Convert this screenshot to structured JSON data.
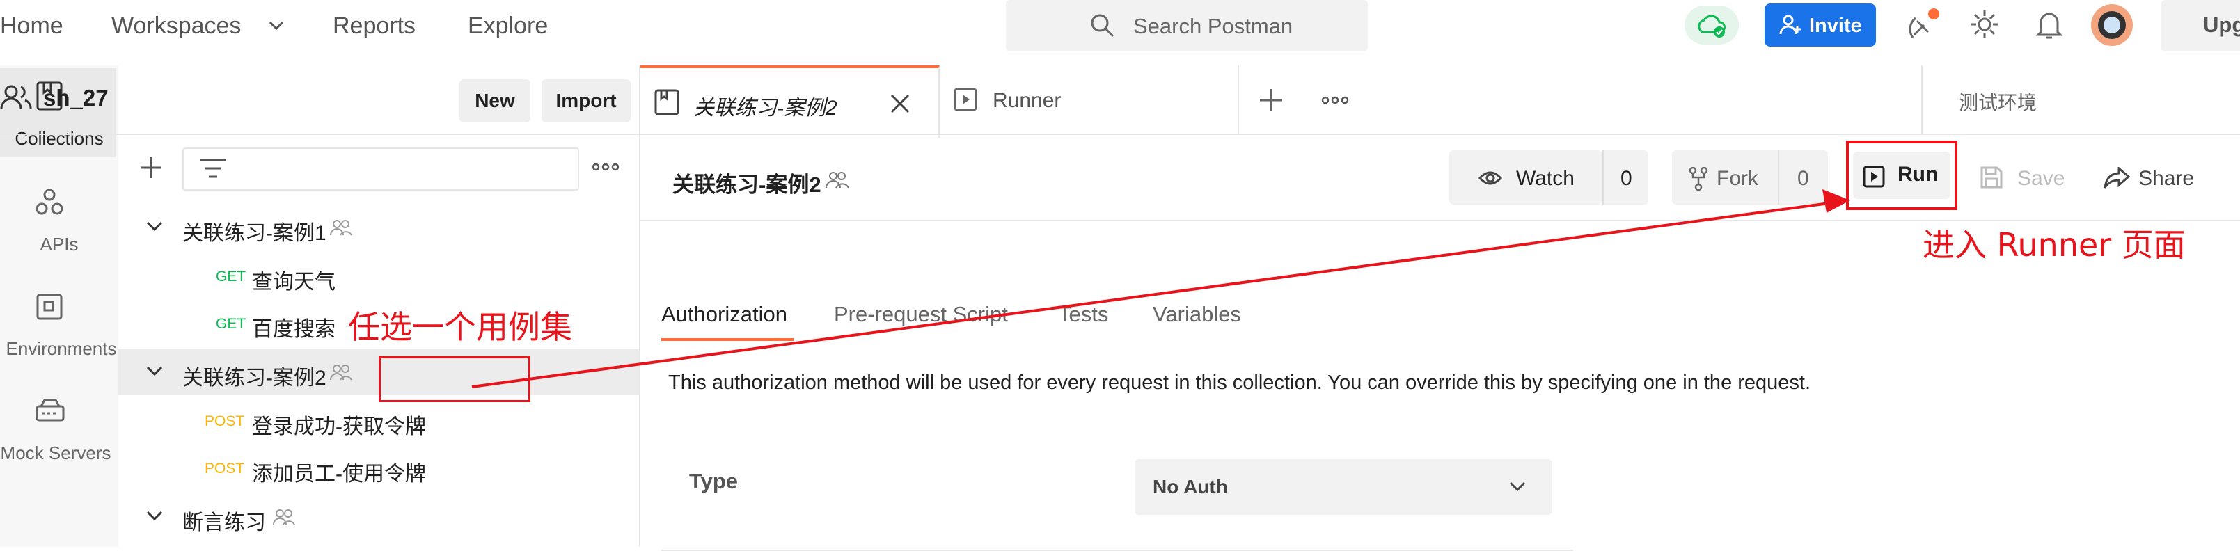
{
  "nav": {
    "home": "Home",
    "workspaces": "Workspaces",
    "reports": "Reports",
    "explore": "Explore",
    "search_placeholder": "Search Postman",
    "invite": "Invite",
    "upgrade": "Upg"
  },
  "workspace": {
    "name": "sh_27",
    "new_label": "New",
    "import_label": "Import"
  },
  "rail": [
    {
      "label": "Collections",
      "icon": "collections-icon"
    },
    {
      "label": "APIs",
      "icon": "apis-icon"
    },
    {
      "label": "Environments",
      "icon": "environments-icon"
    },
    {
      "label": "Mock Servers",
      "icon": "mock-servers-icon"
    }
  ],
  "tree": {
    "c1": {
      "name": "关联练习-案例1"
    },
    "r1": {
      "method": "GET",
      "name": "查询天气"
    },
    "r2": {
      "method": "GET",
      "name": "百度搜索"
    },
    "c2": {
      "name": "关联练习-案例2"
    },
    "r3": {
      "method": "POST",
      "name": "登录成功-获取令牌"
    },
    "r4": {
      "method": "POST",
      "name": "添加员工-使用令牌"
    },
    "c3": {
      "name": "断言练习"
    }
  },
  "tabs": {
    "active": "关联练习-案例2",
    "runner": "Runner",
    "environment": "测试环境"
  },
  "collection": {
    "title": "关联练习-案例2",
    "watch_label": "Watch",
    "watch_count": "0",
    "fork_label": "Fork",
    "fork_count": "0",
    "run_label": "Run",
    "save_label": "Save",
    "share_label": "Share"
  },
  "subtabs": {
    "authorization": "Authorization",
    "prerequest": "Pre-request Script",
    "tests": "Tests",
    "variables": "Variables"
  },
  "auth": {
    "description": "This authorization method will be used for every request in this collection. You can override this by specifying one in the request.",
    "type_label": "Type",
    "type_value": "No Auth"
  },
  "annotations": {
    "pick": "任选一个用例集",
    "enter_runner": "进入 Runner 页面"
  },
  "colors": {
    "accent": "#ff6c37",
    "get": "#0cbb52",
    "post": "#ffb400",
    "annotation": "#e8141b",
    "invite": "#1a73e8"
  }
}
